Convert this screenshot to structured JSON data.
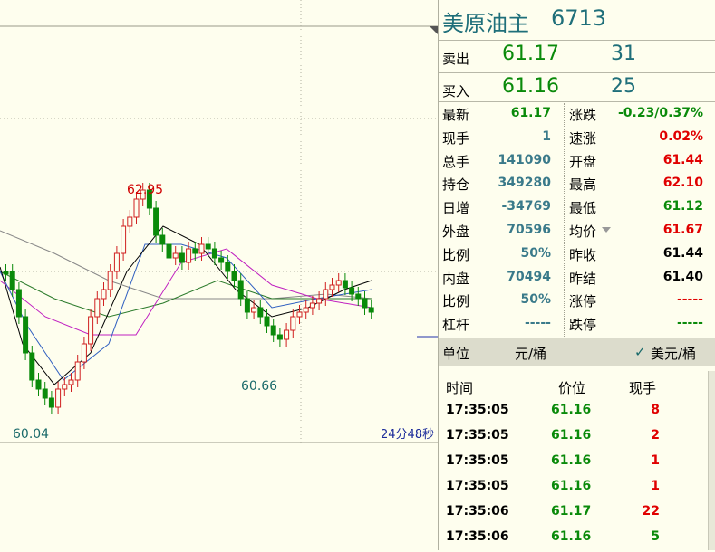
{
  "instrument": {
    "name": "美原油主",
    "code": "6713"
  },
  "quotes": {
    "sell_label": "卖出",
    "sell_price": "61.17",
    "sell_vol": "31",
    "buy_label": "买入",
    "buy_price": "61.16",
    "buy_vol": "25"
  },
  "stats_left": [
    {
      "label": "最新",
      "value": "61.17",
      "color": "green"
    },
    {
      "label": "现手",
      "value": "1",
      "color": "teal"
    },
    {
      "label": "总手",
      "value": "141090",
      "color": "teal"
    },
    {
      "label": "持仓",
      "value": "349280",
      "color": "teal"
    },
    {
      "label": "日增",
      "value": "-34769",
      "color": "teal"
    },
    {
      "label": "外盘",
      "value": "70596",
      "color": "teal"
    },
    {
      "label": "比例",
      "value": "50%",
      "color": "teal"
    },
    {
      "label": "内盘",
      "value": "70494",
      "color": "teal"
    },
    {
      "label": "比例",
      "value": "50%",
      "color": "teal"
    },
    {
      "label": "杠杆",
      "value": "-----",
      "color": "teal"
    }
  ],
  "stats_right": [
    {
      "label": "涨跌",
      "value": "-0.23/0.37%",
      "color": "green"
    },
    {
      "label": "速涨",
      "value": "0.02%",
      "color": "red"
    },
    {
      "label": "开盘",
      "value": "61.44",
      "color": "red"
    },
    {
      "label": "最高",
      "value": "62.10",
      "color": "red"
    },
    {
      "label": "最低",
      "value": "61.12",
      "color": "green"
    },
    {
      "label": "均价",
      "value": "61.67",
      "color": "red"
    },
    {
      "label": "昨收",
      "value": "61.44",
      "color": "black"
    },
    {
      "label": "昨结",
      "value": "61.40",
      "color": "black"
    },
    {
      "label": "涨停",
      "value": "-----",
      "color": "red"
    },
    {
      "label": "跌停",
      "value": "-----",
      "color": "green"
    }
  ],
  "unit": {
    "label": "单位",
    "value": "元/桶",
    "currency": "美元/桶",
    "check": "✓"
  },
  "trades_header": {
    "time": "时间",
    "price": "价位",
    "qty": "现手"
  },
  "trades": [
    {
      "time": "17:35:05",
      "price": "61.16",
      "qty": "8",
      "qty_color": "red"
    },
    {
      "time": "17:35:05",
      "price": "61.16",
      "qty": "2",
      "qty_color": "red"
    },
    {
      "time": "17:35:05",
      "price": "61.16",
      "qty": "1",
      "qty_color": "red"
    },
    {
      "time": "17:35:05",
      "price": "61.16",
      "qty": "1",
      "qty_color": "red"
    },
    {
      "time": "17:35:06",
      "price": "61.17",
      "qty": "22",
      "qty_color": "red"
    },
    {
      "time": "17:35:06",
      "price": "61.16",
      "qty": "5",
      "qty_color": "green"
    }
  ],
  "chart": {
    "high_label": "62.95",
    "low_label": "60.04",
    "mid_low_label": "60.66",
    "countdown": "24分48秒"
  }
}
